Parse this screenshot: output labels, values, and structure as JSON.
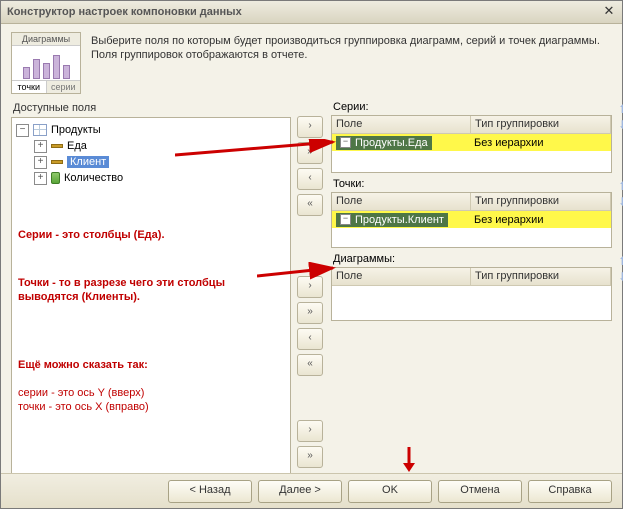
{
  "window": {
    "title": "Конструктор настроек компоновки данных"
  },
  "diagram_thumb": {
    "header": "Диаграммы",
    "foot_left": "точки",
    "foot_right": "серии"
  },
  "description": "Выберите поля по которым будет производиться группировка диаграмм, серий и точек диаграммы. Поля группировок отображаются в отчете.",
  "left_panel": {
    "title": "Доступные поля"
  },
  "tree": {
    "root": "Продукты",
    "children": [
      {
        "label": "Еда"
      },
      {
        "label": "Клиент"
      },
      {
        "label": "Количество"
      }
    ]
  },
  "annotations": {
    "series": "Серии - это столбцы (Еда).",
    "points": "Точки - то в разрезе чего эти столбцы выводятся (Клиенты).",
    "extra1": "Ещё можно сказать так:",
    "extra2": "серии - это ось Y (вверх)",
    "extra3": "точки - это ось X (вправо)"
  },
  "mid_buttons": {
    "right": "›",
    "dright": "»",
    "left": "‹",
    "dleft": "«"
  },
  "series": {
    "title": "Серии:",
    "col_field": "Поле",
    "col_group": "Тип группировки",
    "row_field": "Продукты.Еда",
    "row_group": "Без иерархии"
  },
  "points": {
    "title": "Точки:",
    "col_field": "Поле",
    "col_group": "Тип группировки",
    "row_field": "Продукты.Клиент",
    "row_group": "Без иерархии"
  },
  "diagrams": {
    "title": "Диаграммы:",
    "col_field": "Поле",
    "col_group": "Тип группировки"
  },
  "footer": {
    "back": "< Назад",
    "next": "Далее >",
    "ok": "OK",
    "cancel": "Отмена",
    "help": "Справка"
  }
}
